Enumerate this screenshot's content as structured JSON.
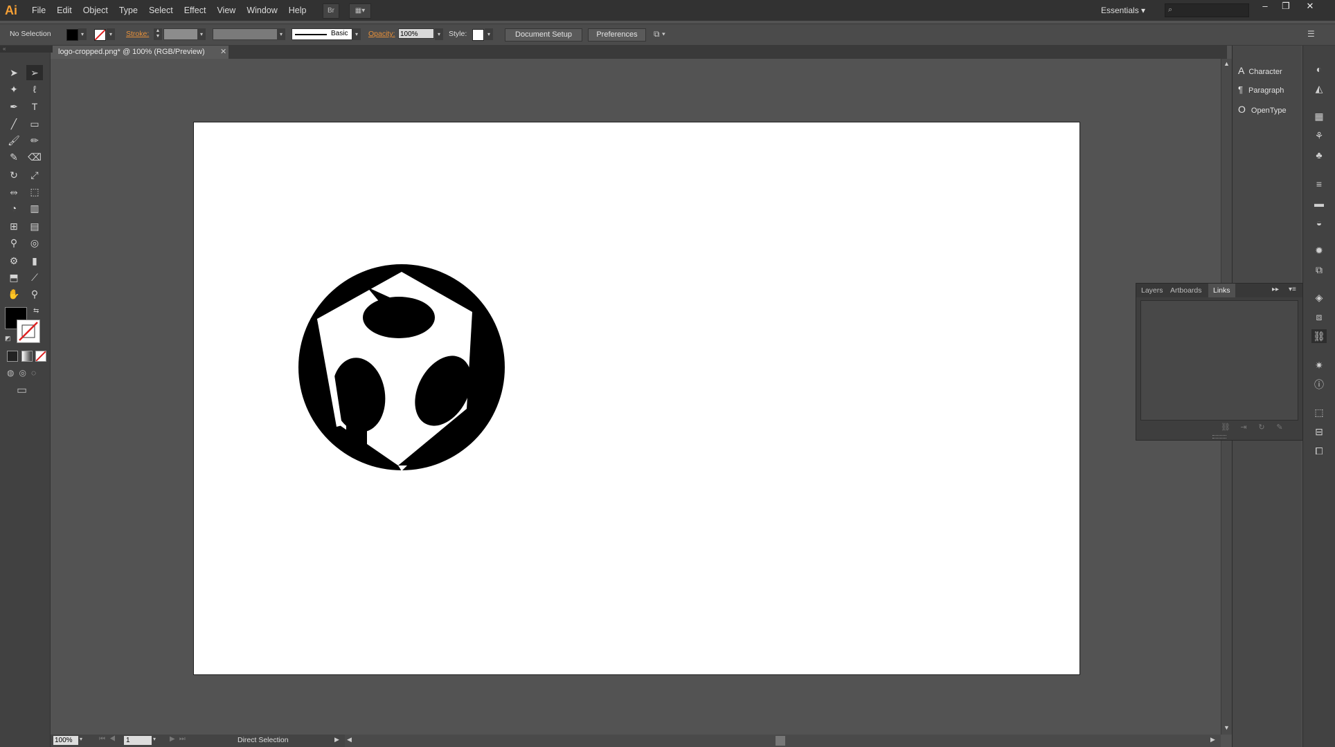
{
  "app": {
    "logo": "Ai"
  },
  "menu": [
    "File",
    "Edit",
    "Object",
    "Type",
    "Select",
    "Effect",
    "View",
    "Window",
    "Help"
  ],
  "menubar": {
    "bridge_label": "Br",
    "workspace": "Essentials",
    "search_placeholder": ""
  },
  "control": {
    "selection": "No Selection",
    "stroke_label": "Stroke:",
    "brush_label": "Basic",
    "opacity_label": "Opacity:",
    "opacity_value": "100%",
    "style_label": "Style:",
    "document_setup": "Document Setup",
    "preferences": "Preferences"
  },
  "document": {
    "tab_title": "logo-cropped.png* @ 100% (RGB/Preview)"
  },
  "status": {
    "zoom": "100%",
    "page": "1",
    "tool": "Direct Selection"
  },
  "char_panel": [
    "Character",
    "Paragraph",
    "OpenType"
  ],
  "links_panel": {
    "tabs": [
      "Layers",
      "Artboards",
      "Links"
    ]
  },
  "colors": {
    "accent": "#f7a035",
    "artboard": "#ffffff",
    "canvas": "#535353",
    "fill": "#000000"
  }
}
